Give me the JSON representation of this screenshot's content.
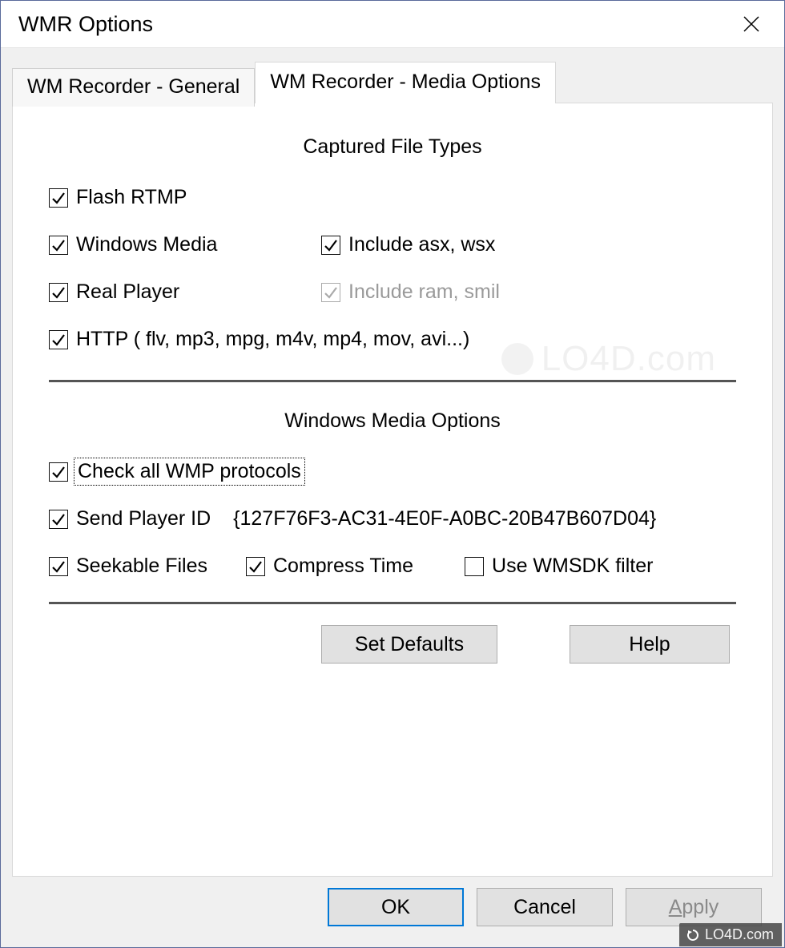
{
  "window": {
    "title": "WMR Options"
  },
  "tabs": {
    "general": "WM Recorder - General",
    "media": "WM Recorder - Media Options"
  },
  "sections": {
    "captured_title": "Captured File Types",
    "wm_options_title": "Windows Media Options"
  },
  "captured": {
    "flash_rtmp": "Flash RTMP",
    "windows_media": "Windows Media",
    "include_asx": "Include asx, wsx",
    "real_player": "Real Player",
    "include_ram": "Include ram, smil",
    "http": "HTTP ( flv, mp3, mpg, m4v, mp4, mov, avi...)"
  },
  "wm_options": {
    "check_all": "Check all WMP protocols",
    "send_player_id": "Send Player ID",
    "player_id_value": "{127F76F3-AC31-4E0F-A0BC-20B47B607D04}",
    "seekable": "Seekable Files",
    "compress": "Compress Time",
    "use_wmsdk": "Use WMSDK filter"
  },
  "buttons": {
    "set_defaults": "Set Defaults",
    "help": "Help",
    "ok": "OK",
    "cancel": "Cancel",
    "apply_prefix": "A",
    "apply_suffix": "pply"
  },
  "watermark": {
    "text": "LO4D.com",
    "ghost": "LO4D.com"
  }
}
